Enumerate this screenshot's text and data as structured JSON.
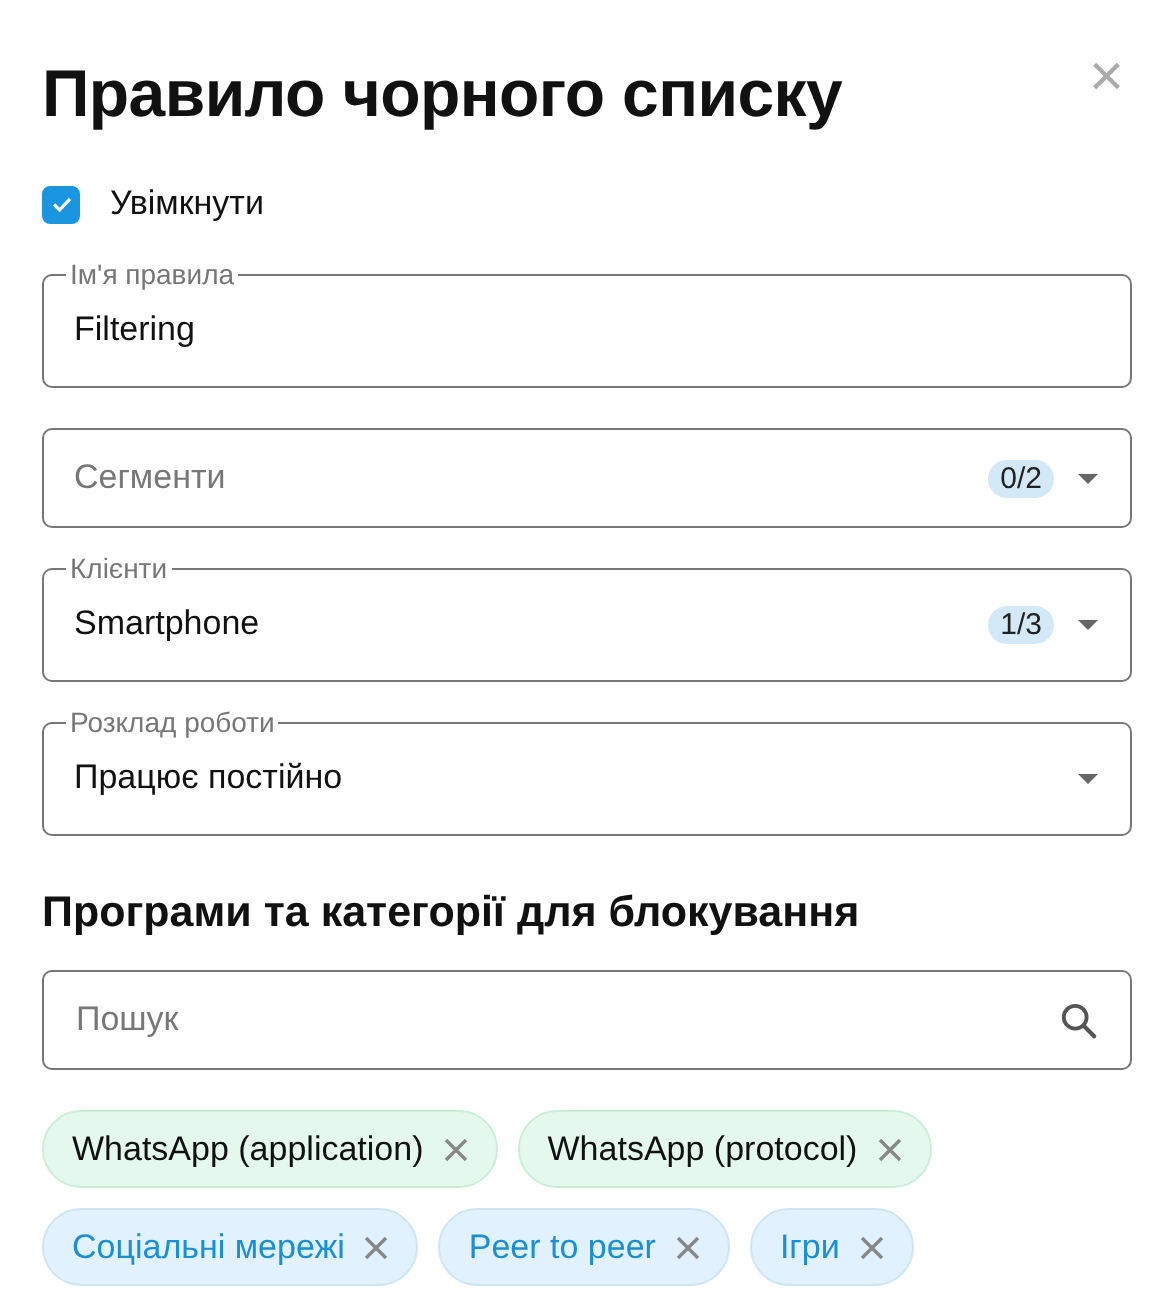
{
  "dialog": {
    "title": "Правило чорного списку",
    "close": "×"
  },
  "enabled": {
    "label": "Увімкнути",
    "checked": true
  },
  "fields": [
    {
      "kind": "text",
      "label": "Ім'я правила",
      "value": "Filtering"
    },
    {
      "kind": "select",
      "placeholder": "Сегменти",
      "count": "0/2"
    },
    {
      "kind": "select",
      "label": "Клієнти",
      "value": "Smartphone",
      "count": "1/3"
    },
    {
      "kind": "select",
      "label": "Розклад роботи",
      "value": "Працює постійно"
    }
  ],
  "section": {
    "title": "Програми та категорії для блокування"
  },
  "search": {
    "placeholder": "Пошук"
  },
  "chips": [
    {
      "kind": "app",
      "label": "WhatsApp (application)"
    },
    {
      "kind": "app",
      "label": "WhatsApp (protocol)"
    },
    {
      "kind": "category",
      "label": "Соціальні мережі"
    },
    {
      "kind": "category",
      "label": "Peer to peer"
    },
    {
      "kind": "category",
      "label": "Ігри"
    }
  ]
}
